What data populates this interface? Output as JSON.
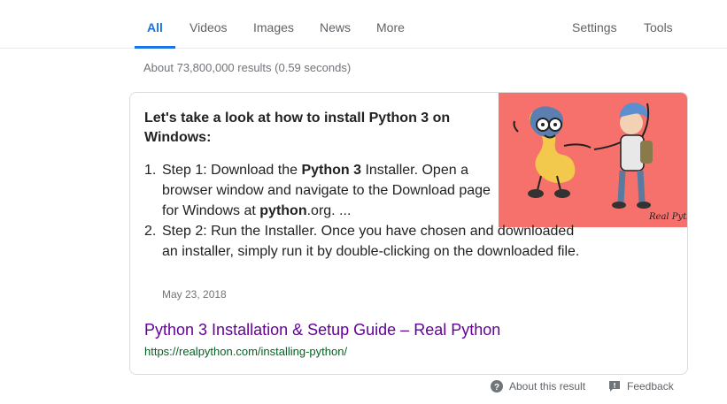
{
  "tabs": {
    "all": "All",
    "videos": "Videos",
    "images": "Images",
    "news": "News",
    "more": "More",
    "settings": "Settings",
    "tools": "Tools"
  },
  "result_stats": "About 73,800,000 results (0.59 seconds)",
  "snippet": {
    "title": "Let's take a look at how to install Python 3 on Windows:",
    "steps": [
      {
        "num": "1.",
        "before": "Step 1: Download the ",
        "bold": "Python 3",
        "middle": " Installer. Open a browser window and navigate to the Download page for Windows at ",
        "bold2": "python",
        "after": ".org. ..."
      },
      {
        "num": "2.",
        "text": "Step 2: Run the Installer. Once you have chosen and downloaded an installer, simply run it by double-clicking on the downloaded file."
      }
    ],
    "date": "May 23, 2018",
    "image_caption": "Real Python",
    "image_bg": "#f6716b"
  },
  "result": {
    "link_text": "Python 3 Installation & Setup Guide – Real Python",
    "url": "https://realpython.com/installing-python/"
  },
  "footer": {
    "about": "About this result",
    "feedback": "Feedback"
  },
  "colors": {
    "accent": "#1a73e8",
    "visited_link": "#660099",
    "url_green": "#006621"
  }
}
